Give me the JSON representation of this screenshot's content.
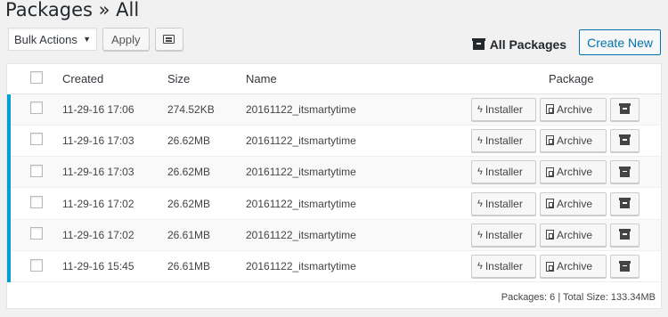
{
  "page": {
    "title": "Packages » All"
  },
  "toolbar": {
    "bulk_actions": "Bulk Actions",
    "apply_label": "Apply",
    "all_packages_label": "All Packages",
    "create_new_label": "Create New"
  },
  "table": {
    "columns": [
      "Created",
      "Size",
      "Name",
      "Package"
    ],
    "rows": [
      {
        "created": "11-29-16 17:06",
        "size": "274.52KB",
        "name": "20161122_itsmartytime"
      },
      {
        "created": "11-29-16 17:03",
        "size": "26.62MB",
        "name": "20161122_itsmartytime"
      },
      {
        "created": "11-29-16 17:03",
        "size": "26.62MB",
        "name": "20161122_itsmartytime"
      },
      {
        "created": "11-29-16 17:02",
        "size": "26.62MB",
        "name": "20161122_itsmartytime"
      },
      {
        "created": "11-29-16 17:02",
        "size": "26.61MB",
        "name": "20161122_itsmartytime"
      },
      {
        "created": "11-29-16 15:45",
        "size": "26.61MB",
        "name": "20161122_itsmartytime"
      }
    ],
    "row_buttons": {
      "installer": "Installer",
      "archive": "Archive"
    },
    "footer": "Packages: 6 | Total Size: 133.34MB"
  },
  "colors": {
    "accent": "#00a0d2",
    "link": "#0073aa"
  }
}
